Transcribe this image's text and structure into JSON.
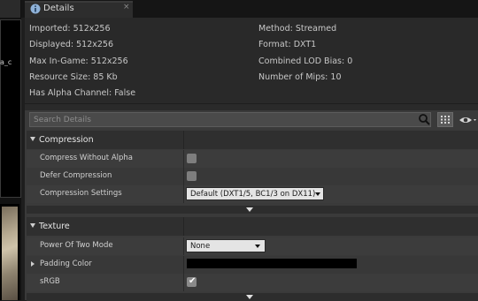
{
  "left": {
    "label": "a_c"
  },
  "tab": {
    "label": "Details",
    "close_icon": "×"
  },
  "info": {
    "left": [
      "Imported: 512x256",
      "Displayed: 512x256",
      "Max In-Game: 512x256",
      "Resource Size: 85 Kb",
      "Has Alpha Channel: False"
    ],
    "right": [
      "Method: Streamed",
      "Format: DXT1",
      "Combined LOD Bias: 0",
      "Number of Mips: 10"
    ]
  },
  "search": {
    "placeholder": "Search Details"
  },
  "compression": {
    "title": "Compression",
    "compress_without_alpha": "Compress Without Alpha",
    "defer_compression": "Defer Compression",
    "compression_settings": "Compression Settings",
    "compression_settings_value": "Default (DXT1/5, BC1/3 on DX11)"
  },
  "texture": {
    "title": "Texture",
    "power_of_two_mode": "Power Of Two Mode",
    "power_of_two_value": "None",
    "padding_color": "Padding Color",
    "srgb": "sRGB",
    "srgb_check": "✔"
  },
  "colors": {
    "background": "#1e1e1e",
    "panel": "#3a3a3a",
    "category": "#2f2f2f",
    "info": "#292929",
    "padding_color_value": "#000000"
  }
}
